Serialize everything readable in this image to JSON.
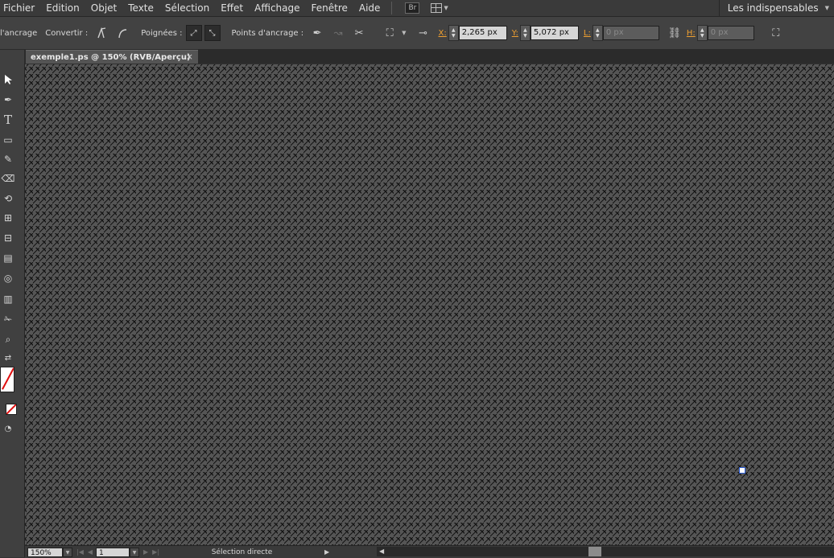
{
  "menu": {
    "items": [
      "Fichier",
      "Edition",
      "Objet",
      "Texte",
      "Sélection",
      "Effet",
      "Affichage",
      "Fenêtre",
      "Aide"
    ],
    "bridge_badge": "Br",
    "workspace_label": "Les indispensables"
  },
  "control": {
    "anchor_label": "l'ancrage",
    "convert_label": "Convertir :",
    "handles_label": "Poignées :",
    "anchor_points_label": "Points d'ancrage :",
    "x_label": "X:",
    "x_value": "2,265 px",
    "y_label": "Y:",
    "y_value": "5,072 px",
    "w_label": "L:",
    "w_value": "0 px",
    "h_label": "H:",
    "h_value": "0 px"
  },
  "document": {
    "tab_title": "exemple1.ps @ 150% (RVB/Aperçu)",
    "close_glyph": "×"
  },
  "status": {
    "zoom": "150%",
    "artboard": "1",
    "tool_status": "Sélection directe"
  },
  "colors": {
    "ui_background": "#323232",
    "canvas": "#555555",
    "coordinate_label": "#f0a030",
    "swatch_slash": "#e01010"
  }
}
